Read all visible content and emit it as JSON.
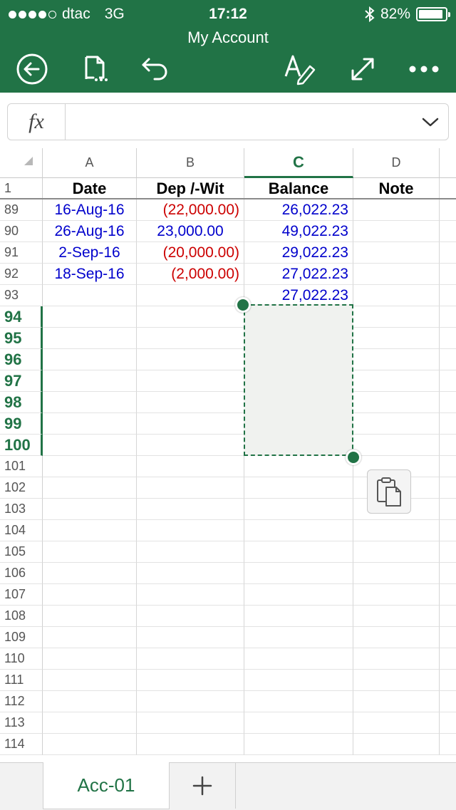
{
  "status_bar": {
    "carrier": "dtac",
    "network": "3G",
    "time": "17:12",
    "battery": "82%",
    "battery_level": 0.82,
    "signal_bars": 4
  },
  "app": {
    "title": "My Account",
    "accent_color": "#217346"
  },
  "toolbar": {
    "icons": [
      "back-icon",
      "file-icon",
      "undo-icon",
      "edit-text-icon",
      "fullscreen-icon",
      "more-icon"
    ]
  },
  "formula_bar": {
    "fx_label": "fx",
    "value": ""
  },
  "columns": [
    {
      "letter": "A",
      "selected": false
    },
    {
      "letter": "B",
      "selected": false
    },
    {
      "letter": "C",
      "selected": true
    },
    {
      "letter": "D",
      "selected": false
    }
  ],
  "header_row": {
    "number": "1",
    "cells": [
      "Date",
      "Dep /-Wit",
      "Balance",
      "Note"
    ]
  },
  "rows": [
    {
      "number": "89",
      "date": "16-Aug-16",
      "amount": "(22,000.00)",
      "amount_negative": true,
      "balance": "26,022.23"
    },
    {
      "number": "90",
      "date": "26-Aug-16",
      "amount": "23,000.00",
      "amount_negative": false,
      "balance": "49,022.23"
    },
    {
      "number": "91",
      "date": "2-Sep-16",
      "amount": "(20,000.00)",
      "amount_negative": true,
      "balance": "29,022.23"
    },
    {
      "number": "92",
      "date": "18-Sep-16",
      "amount": "(2,000.00)",
      "amount_negative": true,
      "balance": "27,022.23"
    },
    {
      "number": "93",
      "date": "",
      "amount": "",
      "amount_negative": false,
      "balance": "27,022.23"
    }
  ],
  "empty_rows": [
    "94",
    "95",
    "96",
    "97",
    "98",
    "99",
    "100",
    "101",
    "102",
    "103",
    "104",
    "105",
    "106",
    "107",
    "108",
    "109",
    "110",
    "111",
    "112",
    "113",
    "114"
  ],
  "selected_rows": [
    "94",
    "95",
    "96",
    "97",
    "98",
    "99",
    "100"
  ],
  "colors": {
    "positive_value": "#0000cc",
    "negative_value": "#cc0000"
  },
  "sheet_tabs": [
    {
      "label": "Acc-01",
      "active": true
    }
  ],
  "add_sheet_label": "+"
}
